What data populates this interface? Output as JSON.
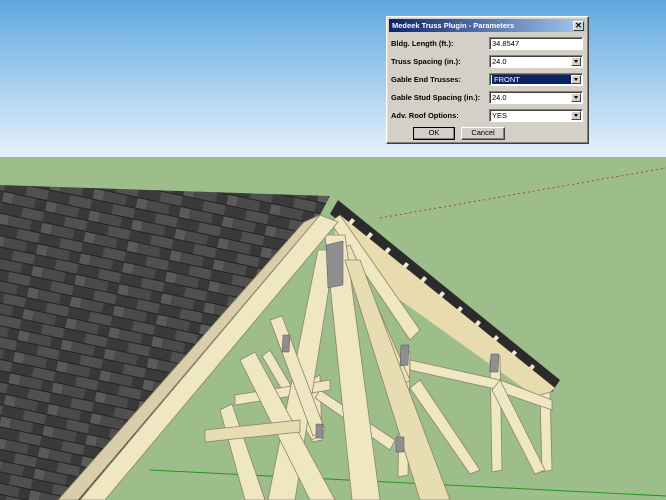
{
  "dialog": {
    "title": "Medeek Truss Plugin - Parameters",
    "close_glyph": "✕",
    "fields": [
      {
        "label": "Bldg. Length (ft.):",
        "value": "34.8547",
        "type": "text"
      },
      {
        "label": "Truss Spacing (in.):",
        "value": "24.0",
        "type": "select"
      },
      {
        "label": "Gable End Trusses:",
        "value": "FRONT",
        "type": "select",
        "selected": true
      },
      {
        "label": "Gable Stud Spacing (in.):",
        "value": "24.0",
        "type": "select"
      },
      {
        "label": "Adv. Roof Options:",
        "value": "YES",
        "type": "select"
      }
    ],
    "ok_label": "OK",
    "cancel_label": "Cancel"
  },
  "colors": {
    "sky_top": "#5ea8e0",
    "sky_bottom": "#e6f2fb",
    "ground": "#9dbd8a",
    "shingle_dark": "#3c3c3c",
    "lumber": "#efe6c2",
    "lumber_shadow": "#b8ad86",
    "dialog_face": "#d4d0c8",
    "title_blue": "#0a246a",
    "select_blue": "#0a246a"
  }
}
